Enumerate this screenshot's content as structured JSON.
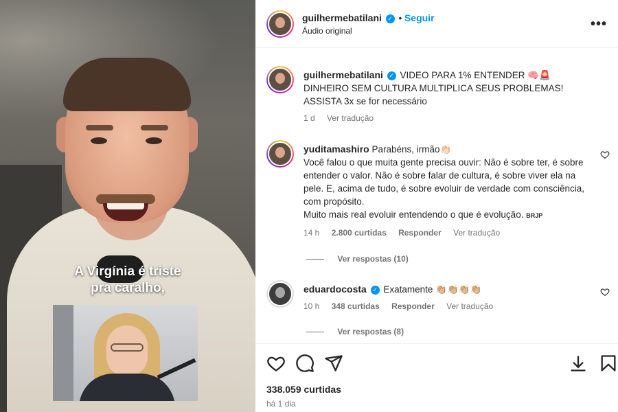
{
  "video": {
    "caption_line1": "A Virgínia é triste",
    "caption_line2": "pra caralho,"
  },
  "header": {
    "username": "guilhermebatilani",
    "separator": "•",
    "follow_label": "Seguir",
    "audio_label": "Áudio original",
    "more_label": "•••"
  },
  "post": {
    "username": "guilhermebatilani",
    "text": "VIDEO PARA 1% ENTENDER 🧠🚨 DINHEIRO SEM CULTURA MULTIPLICA SEUS PROBLEMAS! ASSISTA 3x se for necessário",
    "age": "1 d",
    "translate_label": "Ver tradução"
  },
  "comments": [
    {
      "username": "yuditamashiro",
      "text_line1": "Parabéns, irmão👏🏻",
      "text_rest": "Você falou o que muita gente precisa ouvir: Não é sobre ter, é sobre entender o valor. Não é sobre falar de cultura, é sobre viver ela na pele. E, acima de tudo, é sobre evoluir de verdade com consciência, com propósito.",
      "text_last": "Muito mais real evoluir entendendo o que é evolução.",
      "signature": "BRJP",
      "age": "14 h",
      "likes": "2.800 curtidas",
      "reply_label": "Responder",
      "translate_label": "Ver tradução",
      "view_replies": "Ver respostas (10)"
    },
    {
      "username": "eduardocosta",
      "text": "Exatamente 👏🏼👏🏼👏🏼👏🏼",
      "age": "10 h",
      "likes": "348 curtidas",
      "reply_label": "Responder",
      "translate_label": "Ver tradução",
      "view_replies": "Ver respostas (8)"
    }
  ],
  "footer": {
    "likes": "338.059 curtidas",
    "time": "há 1 dia"
  },
  "icons": [
    "heart-icon",
    "comment-icon",
    "share-icon",
    "download-icon",
    "bookmark-icon",
    "verified-icon",
    "more-icon"
  ],
  "colors": {
    "accent": "#0095f6",
    "muted": "#737373",
    "text": "#262626"
  }
}
